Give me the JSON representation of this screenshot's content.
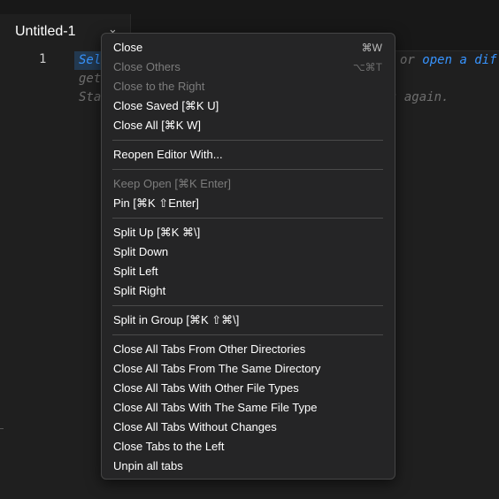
{
  "tab": {
    "label": "Untitled-1",
    "chevron_icon": "chevron-down"
  },
  "editor": {
    "line_number": "1",
    "hint_sel": "Sel",
    "hint_right_1": "or ",
    "hint_right_link": "open a dif",
    "hint_line2": "get",
    "hint_line3": "Sta",
    "hint_right_3": "s again."
  },
  "menu": {
    "close": {
      "label": "Close",
      "shortcut": "⌘W"
    },
    "close_others": {
      "label": "Close Others",
      "shortcut": "⌥⌘T"
    },
    "close_right": {
      "label": "Close to the Right"
    },
    "close_saved": {
      "label": "Close Saved [⌘K U]"
    },
    "close_all": {
      "label": "Close All [⌘K W]"
    },
    "reopen_with": {
      "label": "Reopen Editor With..."
    },
    "keep_open": {
      "label": "Keep Open [⌘K Enter]"
    },
    "pin": {
      "label": "Pin [⌘K ⇧Enter]"
    },
    "split_up": {
      "label": "Split Up [⌘K ⌘\\]"
    },
    "split_down": {
      "label": "Split Down"
    },
    "split_left": {
      "label": "Split Left"
    },
    "split_right": {
      "label": "Split Right"
    },
    "split_group": {
      "label": "Split in Group [⌘K ⇧⌘\\]"
    },
    "close_other_dirs": {
      "label": "Close All Tabs From Other Directories"
    },
    "close_same_dir": {
      "label": "Close All Tabs From The Same Directory"
    },
    "close_other_types": {
      "label": "Close All Tabs With Other File Types"
    },
    "close_same_type": {
      "label": "Close All Tabs With The Same File Type"
    },
    "close_no_changes": {
      "label": "Close All Tabs Without Changes"
    },
    "close_tabs_left": {
      "label": "Close Tabs to the Left"
    },
    "unpin_all": {
      "label": "Unpin all tabs"
    }
  }
}
